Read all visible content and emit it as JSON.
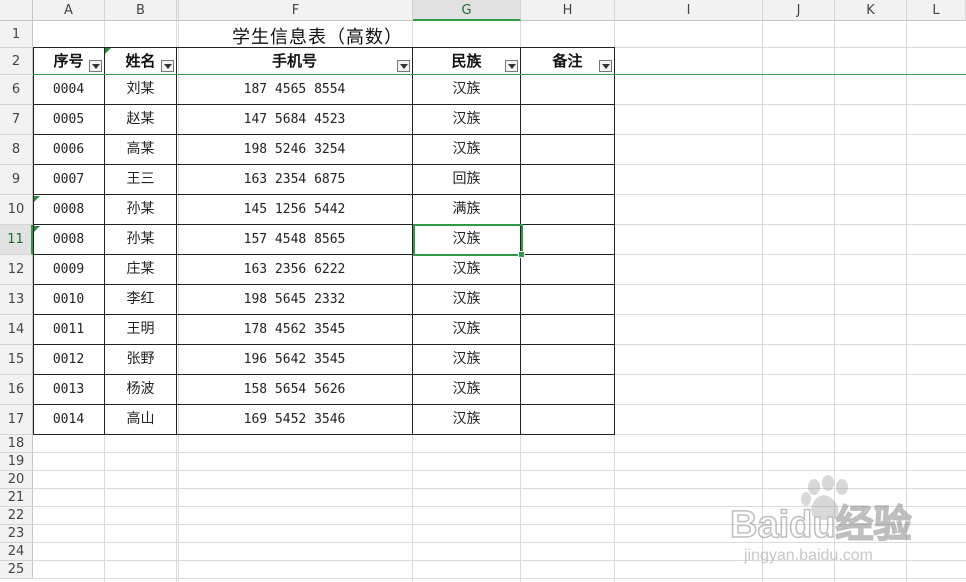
{
  "columns": [
    "A",
    "B",
    "",
    "F",
    "G",
    "H",
    "I",
    "J",
    "K",
    "L"
  ],
  "selected_column": "G",
  "rows_top": [
    "1",
    "2",
    "6",
    "7",
    "8",
    "9",
    "10",
    "11",
    "12",
    "13",
    "14",
    "15",
    "16",
    "17"
  ],
  "rows_bottom": [
    "18",
    "19",
    "20",
    "21",
    "22",
    "23",
    "24",
    "25"
  ],
  "selected_row": "11",
  "title": "学生信息表（高数）",
  "headers": {
    "seq": "序号",
    "name": "姓名",
    "phone": "手机号",
    "nation": "民族",
    "note": "备注"
  },
  "records": [
    {
      "seq": "0004",
      "name": "刘某",
      "phone": "187 4565 8554",
      "nation": "汉族",
      "note": ""
    },
    {
      "seq": "0005",
      "name": "赵某",
      "phone": "147 5684 4523",
      "nation": "汉族",
      "note": ""
    },
    {
      "seq": "0006",
      "name": "高某",
      "phone": "198 5246 3254",
      "nation": "汉族",
      "note": ""
    },
    {
      "seq": "0007",
      "name": "王三",
      "phone": "163 2354 6875",
      "nation": "回族",
      "note": ""
    },
    {
      "seq": "0008",
      "name": "孙某",
      "phone": "145 1256 5442",
      "nation": "满族",
      "note": ""
    },
    {
      "seq": "0008",
      "name": "孙某",
      "phone": "157 4548 8565",
      "nation": "汉族",
      "note": ""
    },
    {
      "seq": "0009",
      "name": "庄某",
      "phone": "163 2356 6222",
      "nation": "汉族",
      "note": ""
    },
    {
      "seq": "0010",
      "name": "李红",
      "phone": "198 5645 2332",
      "nation": "汉族",
      "note": ""
    },
    {
      "seq": "0011",
      "name": "王明",
      "phone": "178 4562 3545",
      "nation": "汉族",
      "note": ""
    },
    {
      "seq": "0012",
      "name": "张野",
      "phone": "196 5642 3545",
      "nation": "汉族",
      "note": ""
    },
    {
      "seq": "0013",
      "name": "杨波",
      "phone": "158 5654 5626",
      "nation": "汉族",
      "note": ""
    },
    {
      "seq": "0014",
      "name": "高山",
      "phone": "169 5452 3546",
      "nation": "汉族",
      "note": ""
    }
  ],
  "watermark": {
    "brand": "Baidu经验",
    "url": "jingyan.baidu.com"
  },
  "colors": {
    "accent": "#2e9a47",
    "grid": "#dadada",
    "header_bg": "#f2f2f2"
  }
}
